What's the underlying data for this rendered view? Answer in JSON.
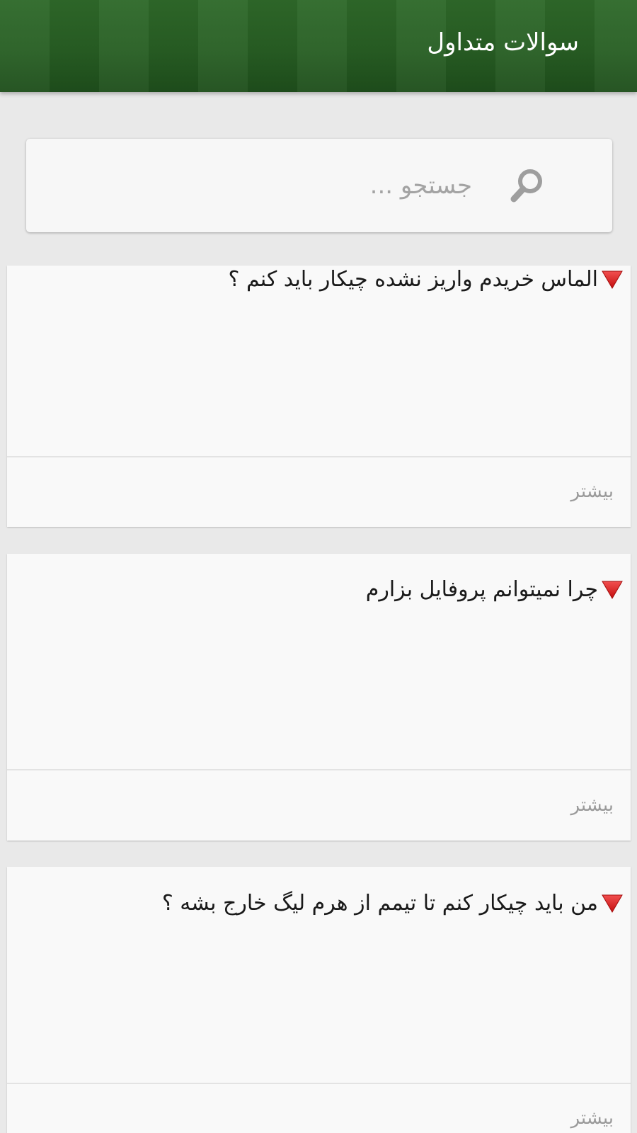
{
  "header": {
    "title": "سوالات متداول"
  },
  "search": {
    "placeholder": "جستجو ...",
    "value": ""
  },
  "faq": {
    "items": [
      {
        "question": "الماس خریدم واریز نشده چیکار باید کنم ؟",
        "more_label": "بیشتر"
      },
      {
        "question": "چرا نمیتوانم پروفایل بزارم",
        "more_label": "بیشتر"
      },
      {
        "question": "من باید چیکار کنم تا تیمم از هرم لیگ خارج بشه ؟",
        "more_label": "بیشتر"
      }
    ]
  },
  "colors": {
    "header_green": "#2a6326",
    "marker_red": "#e01b1b",
    "background": "#e9e9e9",
    "card": "#f9f9f9"
  },
  "icons": {
    "search": "search-icon",
    "question_marker": "red-triangle-icon"
  }
}
